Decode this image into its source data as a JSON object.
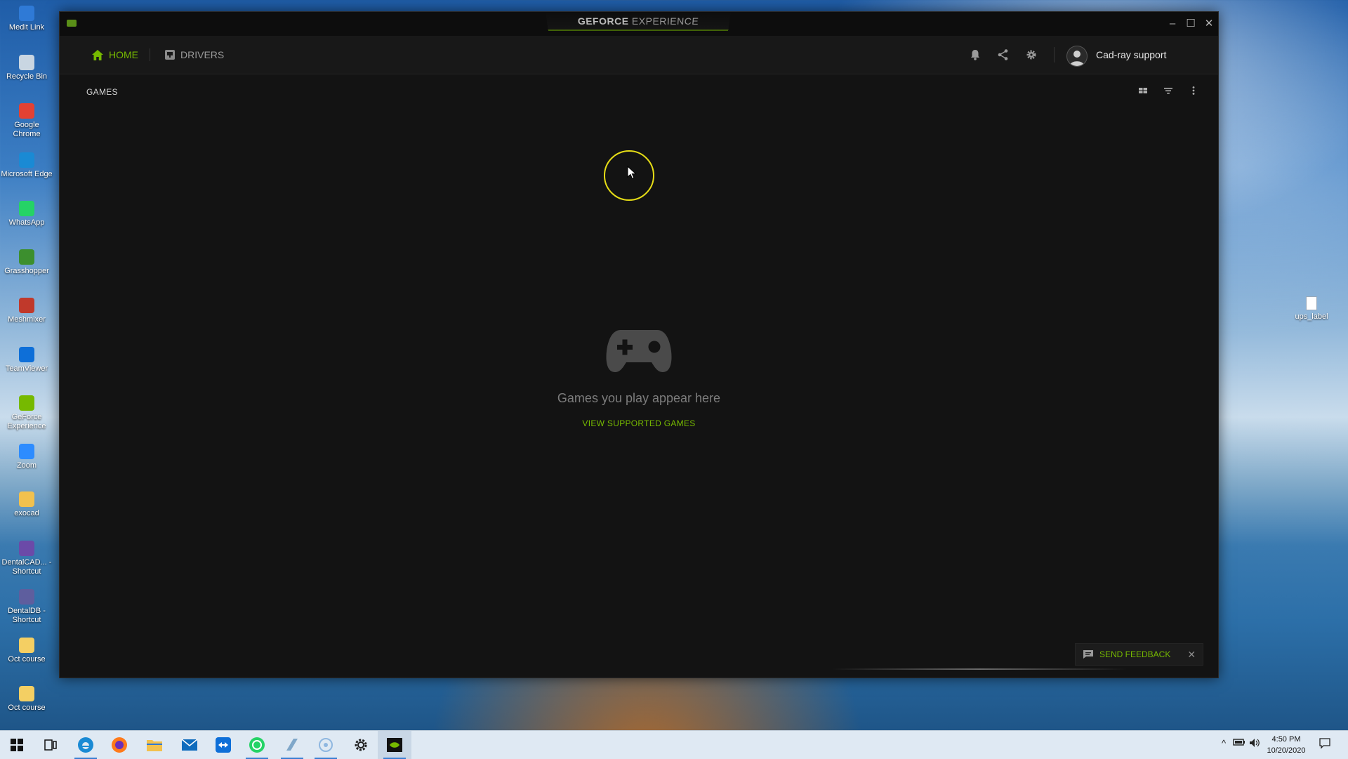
{
  "desktop": {
    "icons": [
      {
        "label": "Medit Link",
        "color": "#2f7ad6"
      },
      {
        "label": "Recycle Bin",
        "color": "#c9d6e2"
      },
      {
        "label": "Google Chrome",
        "color": "#e34133"
      },
      {
        "label": "Microsoft Edge",
        "color": "#1a8ad4"
      },
      {
        "label": "WhatsApp",
        "color": "#25d366"
      },
      {
        "label": "Grasshopper",
        "color": "#3c8f2e"
      },
      {
        "label": "Meshmixer",
        "color": "#c0392b"
      },
      {
        "label": "TeamViewer",
        "color": "#0e6fd8"
      },
      {
        "label": "GeForce Experience",
        "color": "#76b900"
      },
      {
        "label": "Zoom",
        "color": "#2d8cff"
      },
      {
        "label": "exocad",
        "color": "#f2c14e"
      },
      {
        "label": "DentalCAD... - Shortcut",
        "color": "#6b4aa8"
      },
      {
        "label": "DentalDB - Shortcut",
        "color": "#5e5e9e"
      },
      {
        "label": "Oct course",
        "color": "#f4cf63"
      },
      {
        "label": "Oct course",
        "color": "#f4cf63"
      }
    ],
    "right_icon": {
      "label": "ups_label"
    }
  },
  "window": {
    "title_brand": "GEFORCE",
    "title_rest": " EXPERIENCE",
    "controls": {
      "minimize": "–",
      "maximize": "☐",
      "close": "✕"
    }
  },
  "nav": {
    "home_label": "HOME",
    "drivers_label": "DRIVERS",
    "user_name": "Cad-ray support"
  },
  "content": {
    "section_title": "GAMES",
    "empty_message": "Games you play appear here",
    "view_supported_label": "VIEW SUPPORTED GAMES",
    "feedback_label": "SEND FEEDBACK"
  },
  "taskbar": {
    "time": "4:50 PM",
    "date": "10/20/2020"
  },
  "colors": {
    "accent": "#76b900",
    "window_bg": "#131313",
    "cursor_highlight": "#e6dd16"
  }
}
